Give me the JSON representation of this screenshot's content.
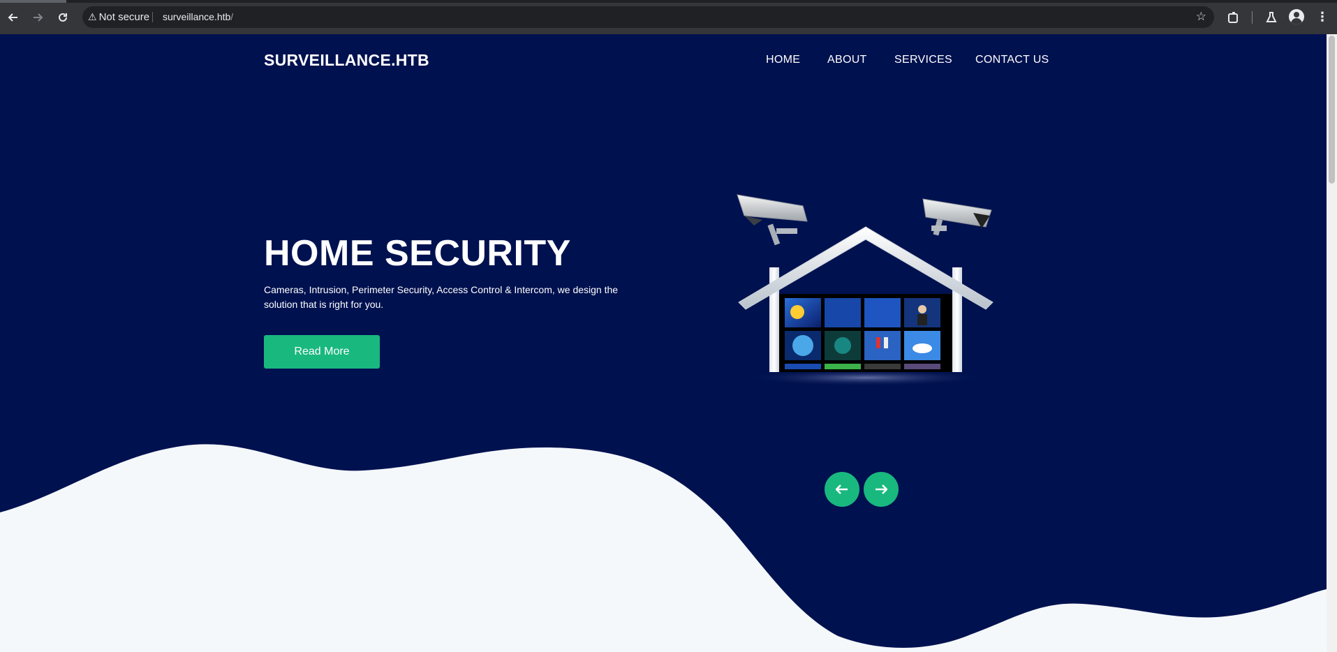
{
  "browser": {
    "nav": {
      "back_icon": "arrow-left-icon",
      "forward_icon": "arrow-right-icon",
      "reload_icon": "reload-icon"
    },
    "security_label": "Not secure",
    "url_host": "surveillance.htb",
    "url_path": "/",
    "bookmark_icon": "star-icon",
    "extensions_icon": "puzzle-icon",
    "labs_icon": "flask-icon",
    "profile_icon": "person-icon",
    "menu_icon": "kebab-menu-icon"
  },
  "site": {
    "brand": "SURVEILLANCE.HTB",
    "menu": [
      "HOME",
      "ABOUT",
      "SERVICES",
      "CONTACT US"
    ]
  },
  "hero": {
    "title": "HOME SECURITY",
    "text": "Cameras, Intrusion, Perimeter Security, Access Control & Intercom, we design the solution that is right for you.",
    "cta": "Read More",
    "illustration": "house-with-security-cameras-and-video-wall",
    "prev_icon": "arrow-left-icon",
    "next_icon": "arrow-right-icon"
  },
  "colors": {
    "hero_bg": "#00114f",
    "accent": "#19b87f",
    "page_bg": "#f4f8fb"
  }
}
